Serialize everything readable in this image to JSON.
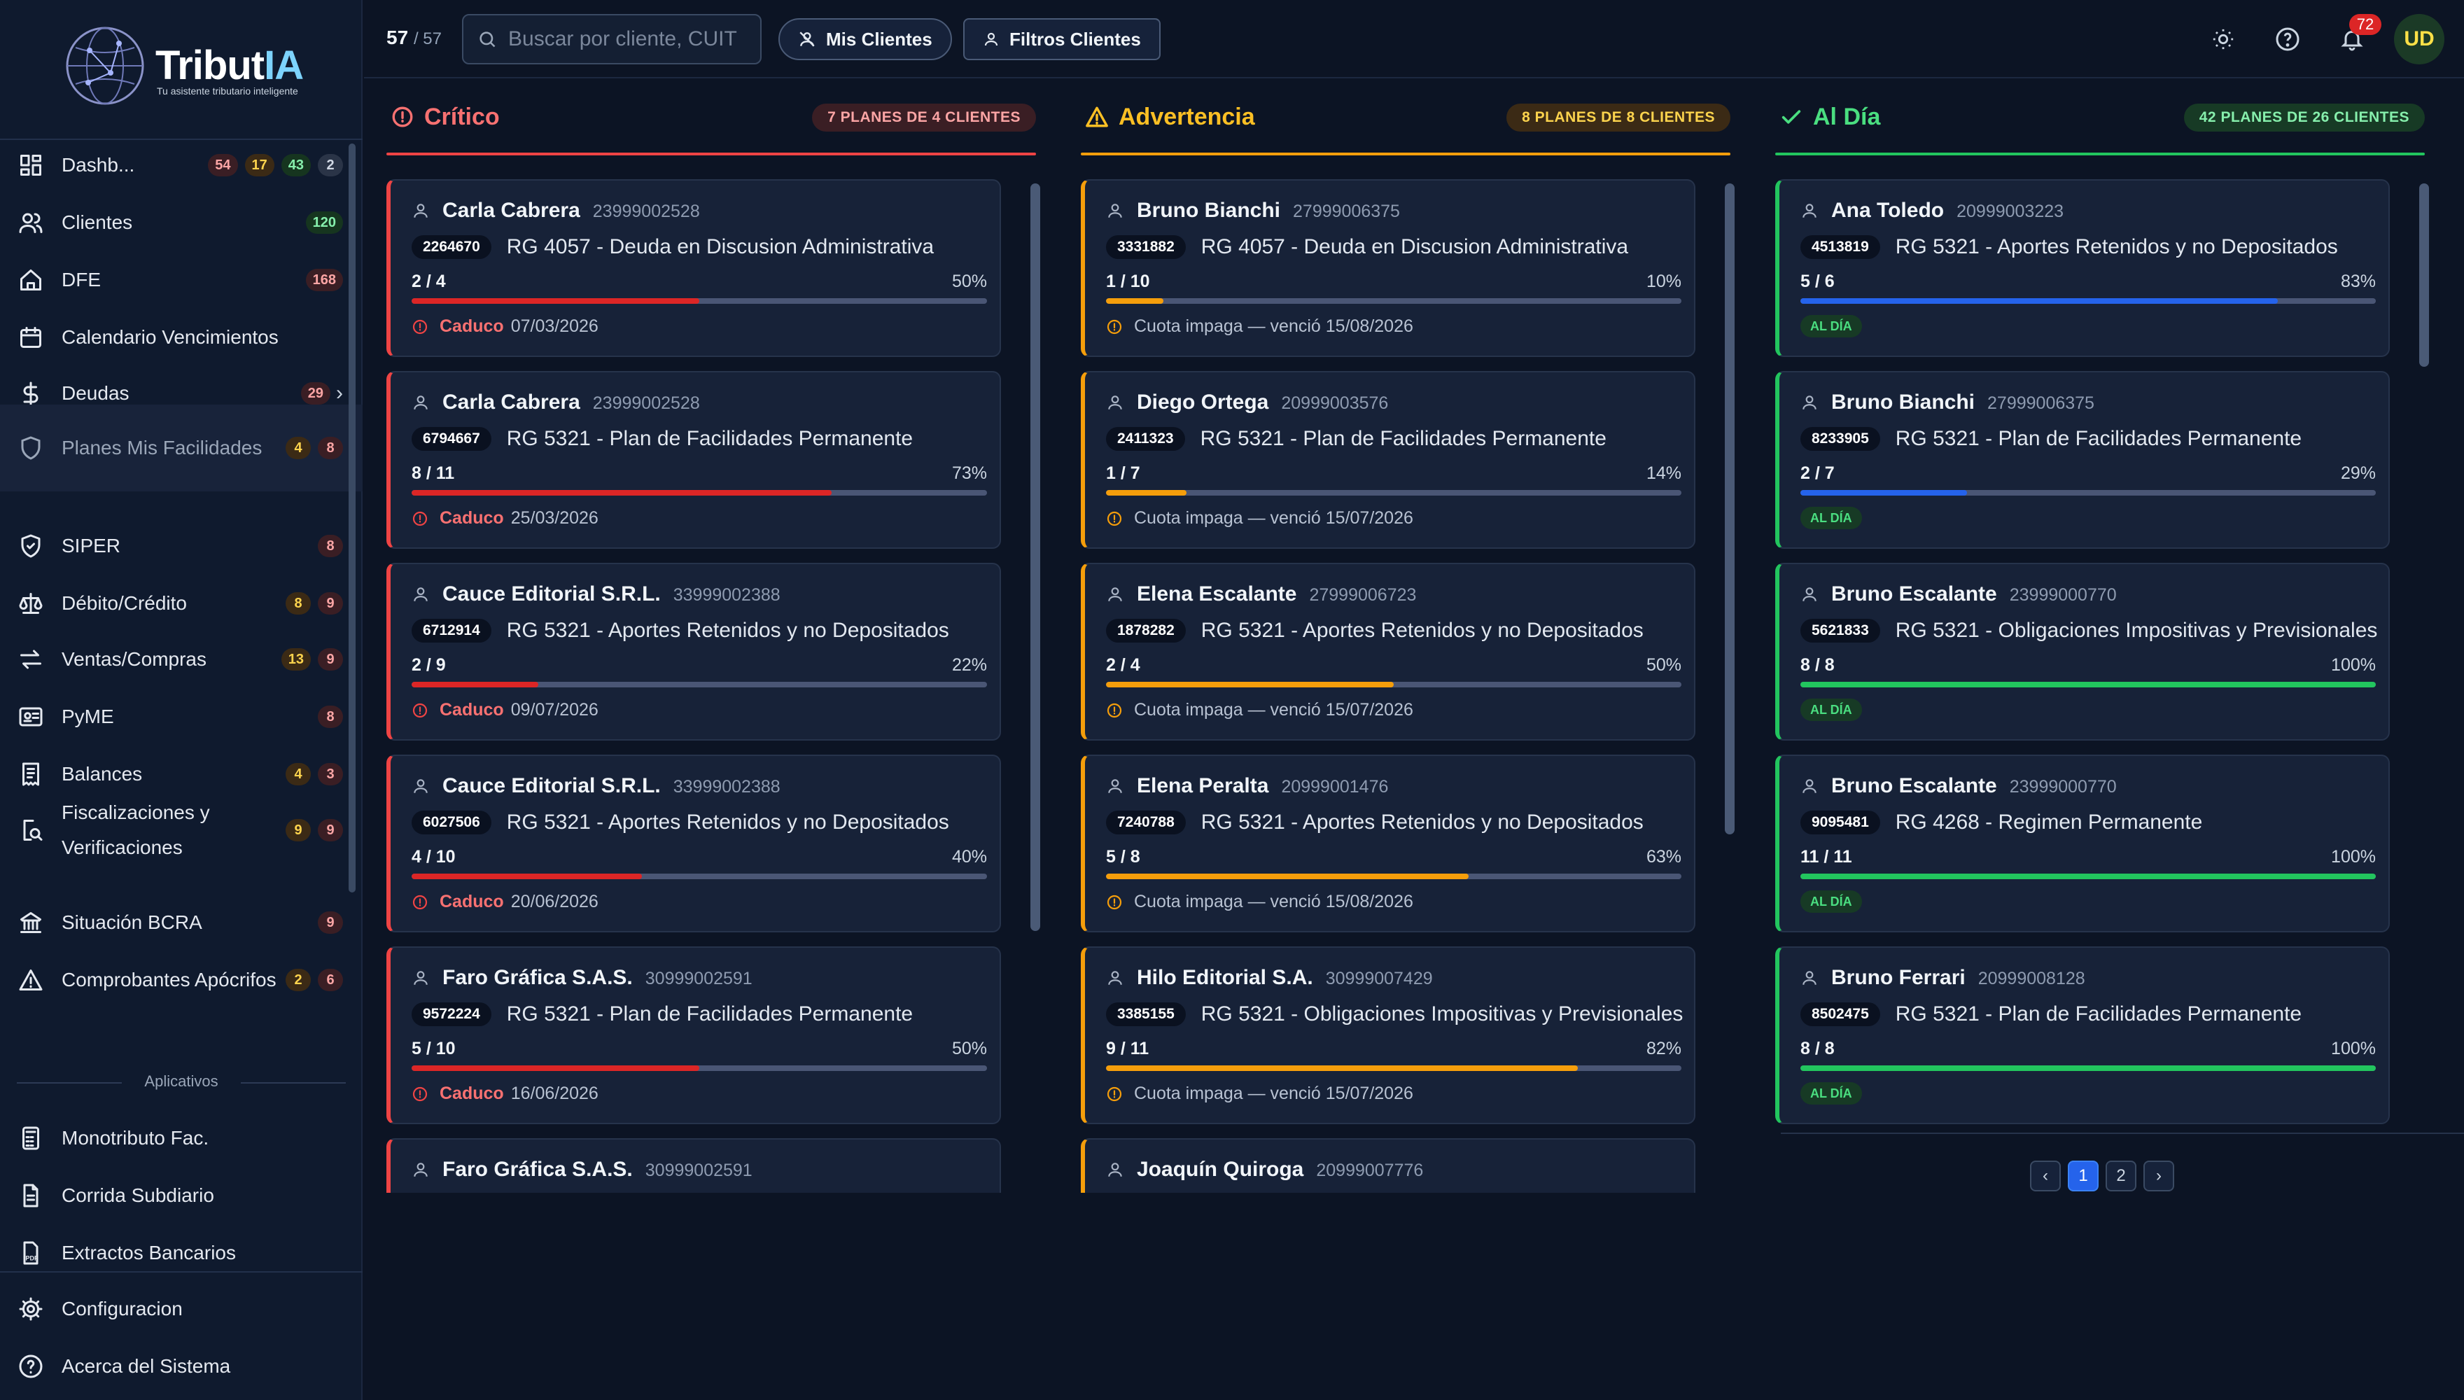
{
  "brand": {
    "name_main": "Tribut",
    "name_accent": "IA",
    "tagline": "Tu asistente tributario inteligente"
  },
  "colors": {
    "critical": "#ef4444",
    "warning": "#f59e0b",
    "ok": "#22c55e",
    "ok_bar": "#2563eb",
    "accent": "#2563eb"
  },
  "sidebar": {
    "items": [
      {
        "label": "Dashb...",
        "icon": "dashboard-icon",
        "badges": [
          "54",
          "17",
          "43",
          "2"
        ]
      },
      {
        "label": "Clientes",
        "icon": "users-icon",
        "badges": [
          "120"
        ]
      },
      {
        "label": "DFE",
        "icon": "home-icon",
        "badges": [
          "168"
        ]
      },
      {
        "label": "Calendario Vencimientos",
        "icon": "calendar-icon",
        "badges": []
      },
      {
        "label": "Deudas",
        "icon": "dollar-icon",
        "badges": [
          "29"
        ]
      },
      {
        "label": "Planes Mis Facilidades",
        "icon": "shield-icon",
        "badges": [
          "4",
          "8"
        ]
      },
      {
        "label": "SIPER",
        "icon": "shield-check-icon",
        "badges": [
          "8"
        ]
      },
      {
        "label": "Débito/Crédito",
        "icon": "scale-icon",
        "badges": [
          "8",
          "9"
        ]
      },
      {
        "label": "Ventas/Compras",
        "icon": "arrows-icon",
        "badges": [
          "13",
          "9"
        ]
      },
      {
        "label": "PyME",
        "icon": "id-card-icon",
        "badges": [
          "8"
        ]
      },
      {
        "label": "Balances",
        "icon": "receipt-icon",
        "badges": [
          "4",
          "3"
        ]
      },
      {
        "label": "Fiscalizaciones y Verificaciones",
        "icon": "search-doc-icon",
        "badges": [
          "9",
          "9"
        ]
      },
      {
        "label": "Situación BCRA",
        "icon": "bank-icon",
        "badges": [
          "9"
        ]
      },
      {
        "label": "Comprobantes Apócrifos",
        "icon": "warning-icon",
        "badges": [
          "2",
          "6"
        ]
      }
    ],
    "apps_label": "Aplicativos",
    "apps": [
      {
        "label": "Monotributo Fac.",
        "icon": "calculator-icon"
      },
      {
        "label": "Corrida Subdiario",
        "icon": "document-icon"
      },
      {
        "label": "Extractos Bancarios",
        "icon": "pdf-icon"
      }
    ],
    "bottom": [
      {
        "label": "Configuracion",
        "icon": "gear-icon"
      },
      {
        "label": "Acerca del Sistema",
        "icon": "help-icon"
      }
    ]
  },
  "topbar": {
    "count": "57",
    "total": "/ 57",
    "search_placeholder": "Buscar por cliente, CUIT",
    "mis_clientes": "Mis Clientes",
    "filtros_clientes": "Filtros Clientes",
    "notifications": "72",
    "avatar": "UD"
  },
  "columns": [
    {
      "title": "Crítico",
      "summary": "7 PLANES DE 4 CLIENTES",
      "cards": [
        {
          "name": "Carla Cabrera",
          "cuit": "23999002528",
          "plan_num": "2264670",
          "plan": "RG 4057 - Deuda en Discusion Administrativa",
          "progress": "2 / 4",
          "pct": "50%",
          "fill": 0.5,
          "status": "Caduco",
          "date": "07/03/2026"
        },
        {
          "name": "Carla Cabrera",
          "cuit": "23999002528",
          "plan_num": "6794667",
          "plan": "RG 5321 - Plan de Facilidades Permanente",
          "progress": "8 / 11",
          "pct": "73%",
          "fill": 0.73,
          "status": "Caduco",
          "date": "25/03/2026"
        },
        {
          "name": "Cauce Editorial S.R.L.",
          "cuit": "33999002388",
          "plan_num": "6712914",
          "plan": "RG 5321 - Aportes Retenidos y no Depositados",
          "progress": "2 / 9",
          "pct": "22%",
          "fill": 0.22,
          "status": "Caduco",
          "date": "09/07/2026"
        },
        {
          "name": "Cauce Editorial S.R.L.",
          "cuit": "33999002388",
          "plan_num": "6027506",
          "plan": "RG 5321 - Aportes Retenidos y no Depositados",
          "progress": "4 / 10",
          "pct": "40%",
          "fill": 0.4,
          "status": "Caduco",
          "date": "20/06/2026"
        },
        {
          "name": "Faro Gráfica S.A.S.",
          "cuit": "30999002591",
          "plan_num": "9572224",
          "plan": "RG 5321 - Plan de Facilidades Permanente",
          "progress": "5 / 10",
          "pct": "50%",
          "fill": 0.5,
          "status": "Caduco",
          "date": "16/06/2026"
        },
        {
          "name": "Faro Gráfica S.A.S.",
          "cuit": "30999002591"
        }
      ]
    },
    {
      "title": "Advertencia",
      "summary": "8 PLANES DE 8 CLIENTES",
      "cards": [
        {
          "name": "Bruno Bianchi",
          "cuit": "27999006375",
          "plan_num": "3331882",
          "plan": "RG 4057 - Deuda en Discusion Administrativa",
          "progress": "1 / 10",
          "pct": "10%",
          "fill": 0.1,
          "note": "Cuota impaga — venció 15/08/2026"
        },
        {
          "name": "Diego Ortega",
          "cuit": "20999003576",
          "plan_num": "2411323",
          "plan": "RG 5321 - Plan de Facilidades Permanente",
          "progress": "1 / 7",
          "pct": "14%",
          "fill": 0.14,
          "note": "Cuota impaga — venció 15/07/2026"
        },
        {
          "name": "Elena Escalante",
          "cuit": "27999006723",
          "plan_num": "1878282",
          "plan": "RG 5321 - Aportes Retenidos y no Depositados",
          "progress": "2 / 4",
          "pct": "50%",
          "fill": 0.5,
          "note": "Cuota impaga — venció 15/07/2026"
        },
        {
          "name": "Elena Peralta",
          "cuit": "20999001476",
          "plan_num": "7240788",
          "plan": "RG 5321 - Aportes Retenidos y no Depositados",
          "progress": "5 / 8",
          "pct": "63%",
          "fill": 0.63,
          "note": "Cuota impaga — venció 15/08/2026"
        },
        {
          "name": "Hilo Editorial S.A.",
          "cuit": "30999007429",
          "plan_num": "3385155",
          "plan": "RG 5321 - Obligaciones Impositivas y Previsionales",
          "progress": "9 / 11",
          "pct": "82%",
          "fill": 0.82,
          "note": "Cuota impaga — venció 15/07/2026"
        },
        {
          "name": "Joaquín Quiroga",
          "cuit": "20999007776"
        }
      ]
    },
    {
      "title": "Al Día",
      "summary": "42 PLANES DE 26 CLIENTES",
      "cards": [
        {
          "name": "Ana Toledo",
          "cuit": "20999003223",
          "plan_num": "4513819",
          "plan": "RG 5321 - Aportes Retenidos y no Depositados",
          "progress": "5 / 6",
          "pct": "83%",
          "fill": 0.83,
          "pill": "AL DÍA",
          "bar": "blue"
        },
        {
          "name": "Bruno Bianchi",
          "cuit": "27999006375",
          "plan_num": "8233905",
          "plan": "RG 5321 - Plan de Facilidades Permanente",
          "progress": "2 / 7",
          "pct": "29%",
          "fill": 0.29,
          "pill": "AL DÍA",
          "bar": "blue"
        },
        {
          "name": "Bruno Escalante",
          "cuit": "23999000770",
          "plan_num": "5621833",
          "plan": "RG 5321 - Obligaciones Impositivas y Previsionales",
          "progress": "8 / 8",
          "pct": "100%",
          "fill": 1.0,
          "pill": "AL DÍA",
          "bar": "green"
        },
        {
          "name": "Bruno Escalante",
          "cuit": "23999000770",
          "plan_num": "9095481",
          "plan": "RG 4268 - Regimen Permanente",
          "progress": "11 / 11",
          "pct": "100%",
          "fill": 1.0,
          "pill": "AL DÍA",
          "bar": "green"
        },
        {
          "name": "Bruno Ferrari",
          "cuit": "20999008128",
          "plan_num": "8502475",
          "plan": "RG 5321 - Plan de Facilidades Permanente",
          "progress": "8 / 8",
          "pct": "100%",
          "fill": 1.0,
          "pill": "AL DÍA",
          "bar": "green"
        }
      ]
    }
  ],
  "pagination": {
    "prev": "‹",
    "pages": [
      "1",
      "2"
    ],
    "next": "›",
    "current": "1"
  }
}
